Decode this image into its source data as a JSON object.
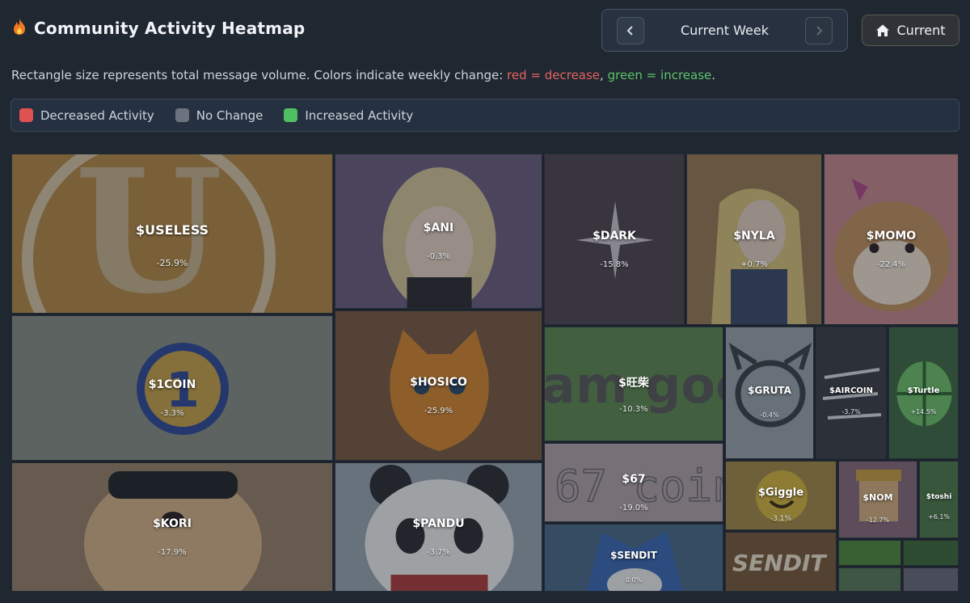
{
  "header": {
    "title": "Community Activity Heatmap",
    "flame_icon": "fire-icon"
  },
  "week_nav": {
    "label": "Current Week",
    "prev_icon": "chevron-left-icon",
    "next_icon": "chevron-right-icon"
  },
  "current_button": {
    "label": "Current",
    "icon": "home-icon"
  },
  "description": {
    "text": "Rectangle size represents total message volume. Colors indicate weekly change: ",
    "red_text": "red = decrease",
    "separator": ", ",
    "green_text": "green = increase",
    "end": "."
  },
  "legend": [
    {
      "label": "Decreased Activity",
      "color": "#e05252"
    },
    {
      "label": "No Change",
      "color": "#6c737e"
    },
    {
      "label": "Increased Activity",
      "color": "#4fbf62"
    }
  ],
  "tiles": [
    {
      "name": "$USELESS",
      "change": "-25.9%"
    },
    {
      "name": "$ANI",
      "change": "-0.3%"
    },
    {
      "name": "$DARK",
      "change": "-15.8%"
    },
    {
      "name": "$NYLA",
      "change": "+0.7%"
    },
    {
      "name": "$MOMO",
      "change": "-22.4%"
    },
    {
      "name": "$1COIN",
      "change": "-3.3%"
    },
    {
      "name": "$HOSICO",
      "change": "-25.9%"
    },
    {
      "name": "$旺柴",
      "change": "-10.3%"
    },
    {
      "name": "$GRUTA",
      "change": "-0.4%"
    },
    {
      "name": "$AIRCOIN",
      "change": "-3.7%"
    },
    {
      "name": "$Turtle",
      "change": "+14.5%"
    },
    {
      "name": "$KORI",
      "change": "-17.9%"
    },
    {
      "name": "$PANDU",
      "change": "-3.7%"
    },
    {
      "name": "$67",
      "change": "-19.0%"
    },
    {
      "name": "$Giggle",
      "change": "-3.1%"
    },
    {
      "name": "$NOM",
      "change": "-12.7%"
    },
    {
      "name": "$toshi",
      "change": "+6.1%"
    },
    {
      "name": "$SENDIT",
      "change": "0.0%"
    }
  ]
}
